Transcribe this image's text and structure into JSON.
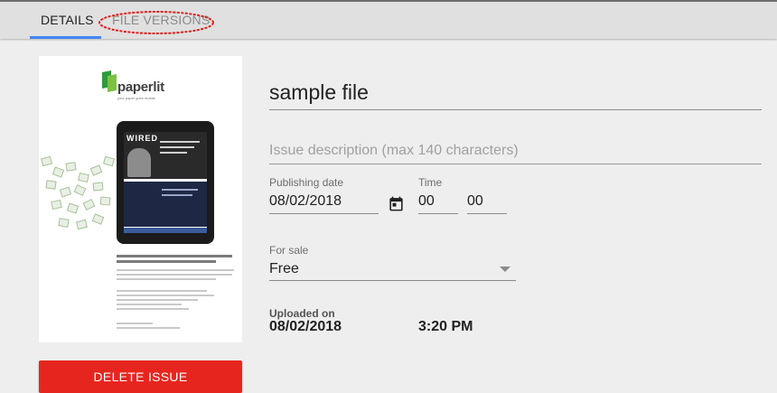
{
  "tabs": {
    "details": "DETAILS",
    "file_versions": "FILE VERSIONS"
  },
  "thumbnail": {
    "logo_text": "paperlit",
    "logo_tagline": "your paper goes mobile",
    "tablet_masthead": "WIRED"
  },
  "form": {
    "title_value": "sample file",
    "description_placeholder": "Issue description (max 140 characters)",
    "publishing_date_label": "Publishing date",
    "publishing_date_value": "08/02/2018",
    "time_label": "Time",
    "time_hour": "00",
    "time_minute": "00",
    "for_sale_label": "For sale",
    "for_sale_value": "Free"
  },
  "upload": {
    "label": "Uploaded on",
    "date": "08/02/2018",
    "time": "3:20 PM"
  },
  "actions": {
    "delete_label": "DELETE ISSUE"
  },
  "colors": {
    "tab_indicator": "#4285f4",
    "delete_button": "#e6261e",
    "annotation": "#e0201c"
  }
}
